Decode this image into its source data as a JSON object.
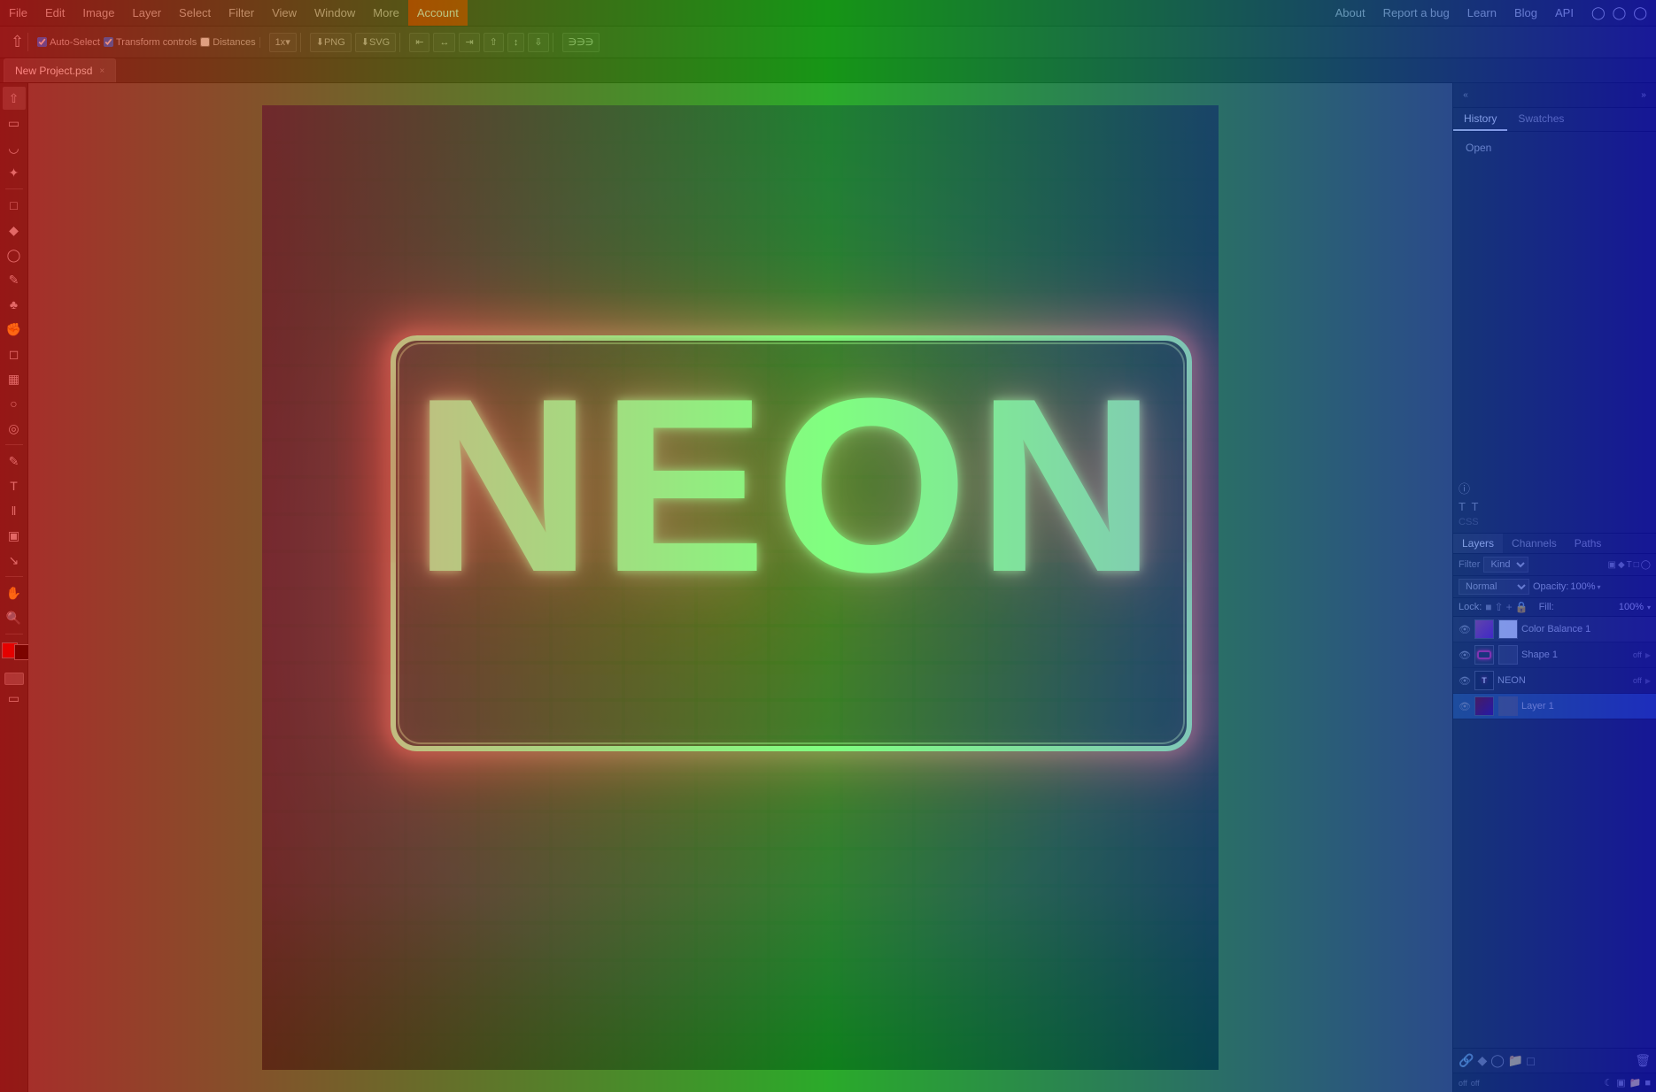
{
  "app": {
    "title": "Photopea"
  },
  "menubar": {
    "items": [
      "File",
      "Edit",
      "Image",
      "Layer",
      "Select",
      "Filter",
      "View",
      "Window",
      "More",
      "Account"
    ],
    "right_items": [
      "About",
      "Report a bug",
      "Learn",
      "Blog",
      "API"
    ]
  },
  "toolbar": {
    "auto_select_label": "Auto-Select",
    "transform_controls_label": "Transform controls",
    "distances_label": "Distances",
    "scale_label": "1x",
    "png_label": "PNG",
    "svg_label": "SVG"
  },
  "tab": {
    "name": "New Project.psd",
    "close": "×"
  },
  "history": {
    "tab_label": "History",
    "swatches_tab": "Swatches",
    "item": "Open"
  },
  "layers_panel": {
    "tabs": [
      "Layers",
      "Channels",
      "Paths"
    ],
    "filter_label": "Filter",
    "kind_label": "Kind",
    "blend_mode": "Normal",
    "opacity_label": "Opacity:",
    "opacity_value": "100%",
    "lock_label": "Lock:",
    "fill_label": "Fill:",
    "fill_value": "100%",
    "layers": [
      {
        "name": "Color Balance 1",
        "type": "adjustment",
        "visible": true,
        "selected": false,
        "effect": ""
      },
      {
        "name": "Shape 1",
        "type": "shape",
        "visible": true,
        "selected": false,
        "effect": "off"
      },
      {
        "name": "NEON",
        "type": "text",
        "visible": true,
        "selected": false,
        "effect": "off"
      },
      {
        "name": "Layer 1",
        "type": "raster",
        "visible": true,
        "selected": true,
        "effect": ""
      }
    ]
  },
  "canvas": {
    "neon_text": "NEON"
  },
  "status_bar": {
    "items": [
      "off",
      "off"
    ]
  },
  "right_panel_bottom": {
    "icons": [
      "lock",
      "new-layer",
      "folder",
      "trash"
    ]
  }
}
